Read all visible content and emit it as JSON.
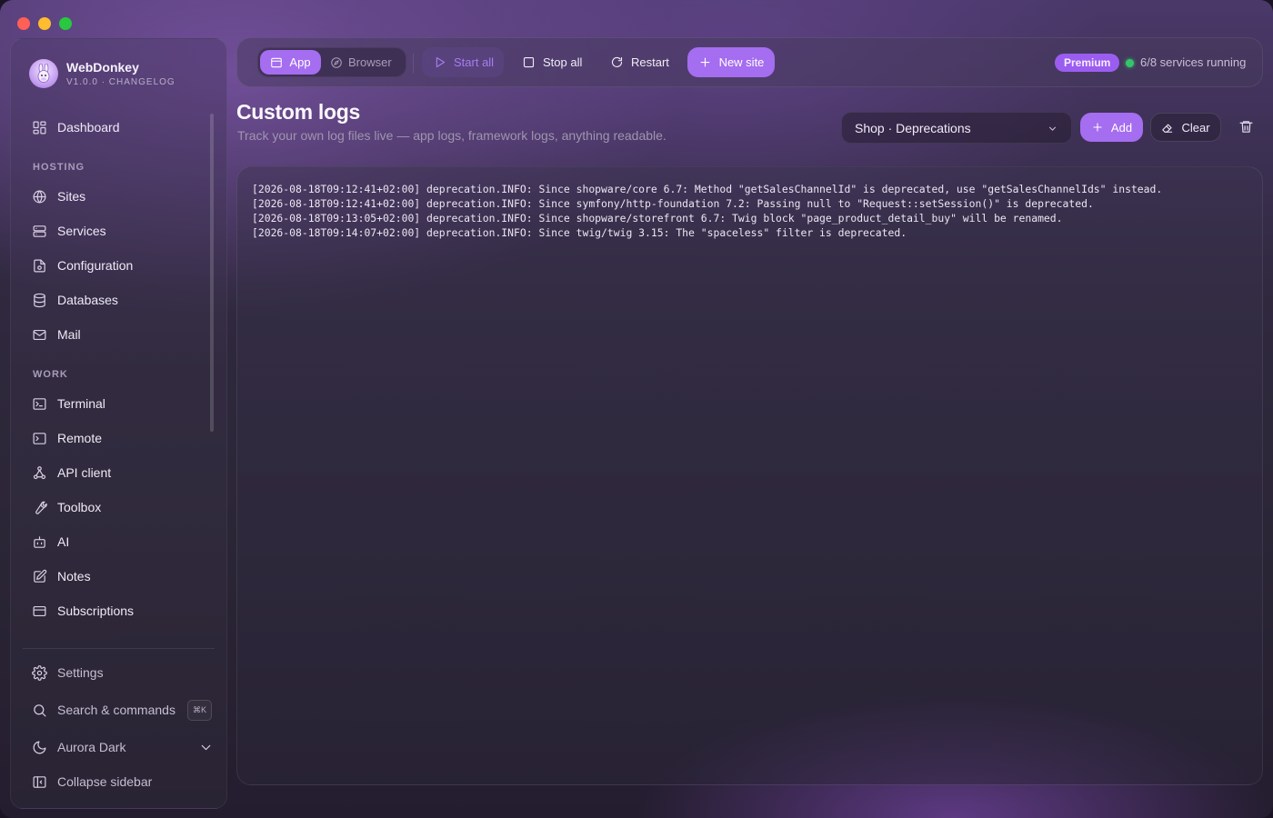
{
  "app": {
    "name": "WebDonkey",
    "version": "V1.0.0 · CHANGELOG"
  },
  "sidebar": {
    "items": [
      {
        "label": "Dashboard",
        "icon": "dashboard-icon"
      }
    ],
    "sections": [
      {
        "label": "HOSTING",
        "items": [
          {
            "label": "Sites",
            "icon": "globe-icon"
          },
          {
            "label": "Services",
            "icon": "server-icon"
          },
          {
            "label": "Configuration",
            "icon": "config-file-icon"
          },
          {
            "label": "Databases",
            "icon": "database-icon"
          },
          {
            "label": "Mail",
            "icon": "mail-icon"
          }
        ]
      },
      {
        "label": "WORK",
        "items": [
          {
            "label": "Terminal",
            "icon": "terminal-icon"
          },
          {
            "label": "Remote",
            "icon": "remote-terminal-icon"
          },
          {
            "label": "API client",
            "icon": "api-client-icon"
          },
          {
            "label": "Toolbox",
            "icon": "wrench-icon"
          },
          {
            "label": "AI",
            "icon": "robot-icon"
          },
          {
            "label": "Notes",
            "icon": "notes-icon"
          },
          {
            "label": "Subscriptions",
            "icon": "credit-card-icon"
          }
        ]
      }
    ],
    "footer": {
      "settings": "Settings",
      "search": "Search & commands",
      "search_shortcut": "⌘K",
      "theme": "Aurora Dark",
      "collapse": "Collapse sidebar"
    }
  },
  "toolbar": {
    "app_tab": "App",
    "browser_tab": "Browser",
    "start_all": "Start all",
    "stop_all": "Stop all",
    "restart": "Restart",
    "new_site": "New site",
    "premium_badge": "Premium",
    "status_text": "6/8 services running",
    "status_color": "#36c46a",
    "accent_color": "#a56df0"
  },
  "page": {
    "title": "Custom logs",
    "subtitle": "Track your own log files live — app logs, framework logs, anything readable.",
    "selected_log": "Shop · Deprecations",
    "add_label": "Add",
    "clear_label": "Clear"
  },
  "logs": [
    "[2026-08-18T09:12:41+02:00] deprecation.INFO: Since shopware/core 6.7: Method \"getSalesChannelId\" is deprecated, use \"getSalesChannelIds\" instead.",
    "[2026-08-18T09:12:41+02:00] deprecation.INFO: Since symfony/http-foundation 7.2: Passing null to \"Request::setSession()\" is deprecated.",
    "[2026-08-18T09:13:05+02:00] deprecation.INFO: Since shopware/storefront 6.7: Twig block \"page_product_detail_buy\" will be renamed.",
    "[2026-08-18T09:14:07+02:00] deprecation.INFO: Since twig/twig 3.15: The \"spaceless\" filter is deprecated."
  ]
}
